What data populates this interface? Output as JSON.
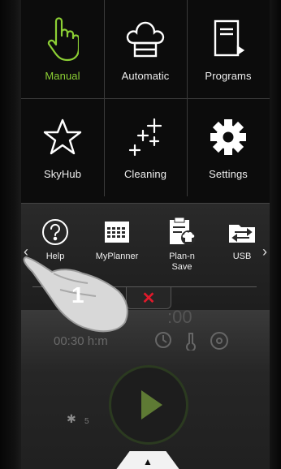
{
  "tiles": [
    {
      "label": "Manual",
      "icon": "hand-pointer-icon",
      "active": true
    },
    {
      "label": "Automatic",
      "icon": "chef-hat-icon"
    },
    {
      "label": "Programs",
      "icon": "book-icon"
    },
    {
      "label": "SkyHub",
      "icon": "star-icon"
    },
    {
      "label": "Cleaning",
      "icon": "sparkles-icon"
    },
    {
      "label": "Settings",
      "icon": "gear-icon"
    }
  ],
  "quick": [
    {
      "label": "Help",
      "icon": "question-circle-icon"
    },
    {
      "label": "MyPlanner",
      "icon": "calendar-icon"
    },
    {
      "label": "Plan-n\nSave",
      "icon": "clipboard-chef-icon"
    },
    {
      "label": "USB",
      "icon": "usb-folder-icon"
    }
  ],
  "nav": {
    "prev": "‹",
    "next": "›",
    "close": "✕"
  },
  "status": {
    "time_big": ":00",
    "time_small": "00:30 h:m",
    "fan": "✱",
    "fan_level": "5"
  },
  "annotation": {
    "step": "1"
  },
  "drawer": {
    "symbol": "▲"
  },
  "colors": {
    "accent": "#8ccf34",
    "close": "#e0192b",
    "background": "#0a0a0a"
  }
}
